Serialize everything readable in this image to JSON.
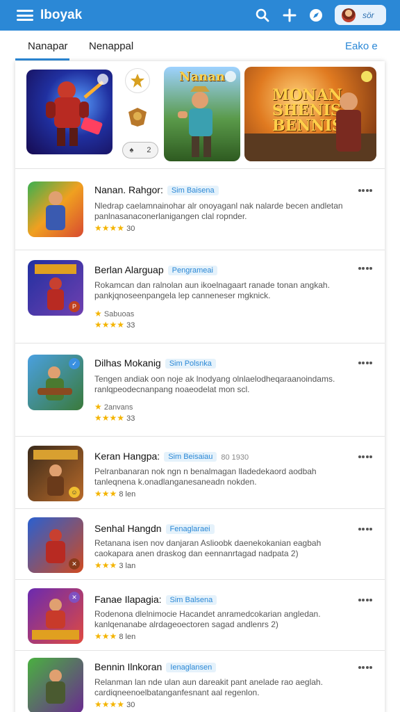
{
  "app": {
    "title": "Iboyak",
    "profile_label": "sör"
  },
  "tabs": [
    {
      "label": "Nanapar"
    },
    {
      "label": "Nenappal"
    }
  ],
  "tab_right": "Eako e",
  "featured": {
    "tile2_text": "Nanan",
    "tile3_text": "MONAN SHENIS BENNIS"
  },
  "items": [
    {
      "title": "Nanan. Rahgor:",
      "tag": "Sim Baisena",
      "desc": "Nledrap caelamnainohar alr onoyaganl nak nalarde becen andletan panlnasanaconerlanigangen clal ropnder.",
      "sub": "",
      "rating": "30"
    },
    {
      "title": "Berlan Alarguap",
      "tag": "Pengrameai",
      "desc": "Rokamcan dan ralnolan aun ikoelnagaart ranade tonan angkah. pankjqnoseenpangela lep canneneser mgknick.",
      "sub": "Sabuoas",
      "rating": "33"
    },
    {
      "title": "Dilhas Mokanig",
      "tag": "Sim Polsnka",
      "desc": "Tengen andiak oon noje ak lnodyang olnlaelodheqaraanoindams. ranlqpeodecnanpang noaeodelat mon scl.",
      "sub": "2anvans",
      "rating": "33"
    },
    {
      "title": "Keran Hangpa:",
      "tag": "Sim Beisaiau",
      "extra": "80 1930",
      "desc": "Pelranbanaran nok ngn n benalmagan lladedekaord aodbah tanleqnena k.onadlanganesaneadn nokden.",
      "sub": "",
      "rating": "8 len"
    },
    {
      "title": "Senhal Hangdn",
      "tag": "Fenaglaraei",
      "desc": "Retanana isen nov danjaran Aslioobk daenekokanian eagbah caokapara anen draskog dan eennanrtagad nadpata 2)",
      "sub": "",
      "rating": "3 lan"
    },
    {
      "title": "Fanae Ilapagia:",
      "tag": "Sim Balsena",
      "desc": "Rodenona dlelnimocie Hacandet anramedcokarian angledan. kanlqenanabe alrdageoectoren sagad andlenrs 2)",
      "sub": "",
      "rating": "8 len"
    },
    {
      "title": "Bennin Ilnkoran",
      "tag": "Ienaglansen",
      "desc": "Relanman lan nde ulan aun dareakit pant anelade rao aeglah. cardiqneenoelbatanganfesnant aal regenlon.",
      "sub": "",
      "rating": "30"
    }
  ],
  "colors": {
    "primary": "#2b88d6",
    "star": "#f4b400",
    "tag_bg": "#e5f2fb"
  },
  "icons": [
    "menu-icon",
    "search-icon",
    "plus-icon",
    "compass-icon",
    "more-icon",
    "star-icon"
  ]
}
